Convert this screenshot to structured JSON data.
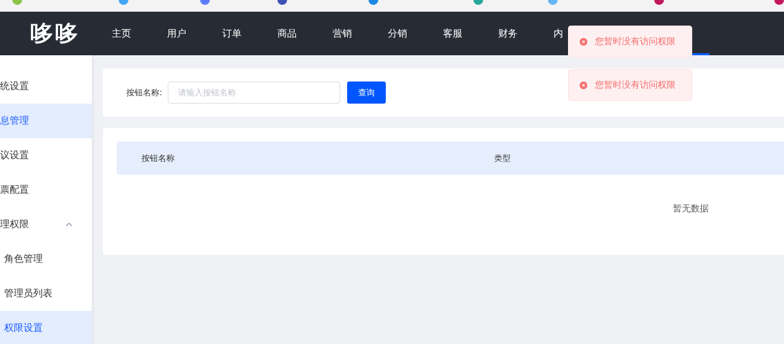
{
  "header": {
    "logo": "哆哆",
    "nav": [
      {
        "label": "主页",
        "selected": false
      },
      {
        "label": "用户",
        "selected": false
      },
      {
        "label": "订单",
        "selected": false
      },
      {
        "label": "商品",
        "selected": false
      },
      {
        "label": "营销",
        "selected": false
      },
      {
        "label": "分销",
        "selected": false
      },
      {
        "label": "客服",
        "selected": false
      },
      {
        "label": "财务",
        "selected": false
      },
      {
        "label": "内",
        "selected": false
      }
    ]
  },
  "sidebar": {
    "items": [
      {
        "label": "统设置",
        "selected": false
      },
      {
        "label": "息管理",
        "selected": true
      },
      {
        "label": "议设置",
        "selected": false
      },
      {
        "label": "票配置",
        "selected": false
      },
      {
        "label": "理权限",
        "selected": false,
        "expanded": true,
        "children": [
          {
            "label": "角色管理",
            "selected": false
          },
          {
            "label": "管理员列表",
            "selected": false
          },
          {
            "label": "权限设置",
            "selected": true
          }
        ]
      }
    ]
  },
  "search": {
    "label": "按钮名称:",
    "placeholder": "请输入按钮名称",
    "button": "查询"
  },
  "table": {
    "columns": [
      "按钮名称",
      "类型"
    ],
    "empty_text": "暂无数据"
  },
  "toasts": [
    {
      "message": "您暂时没有访问权限"
    },
    {
      "message": "您暂时没有访问权限"
    }
  ]
}
